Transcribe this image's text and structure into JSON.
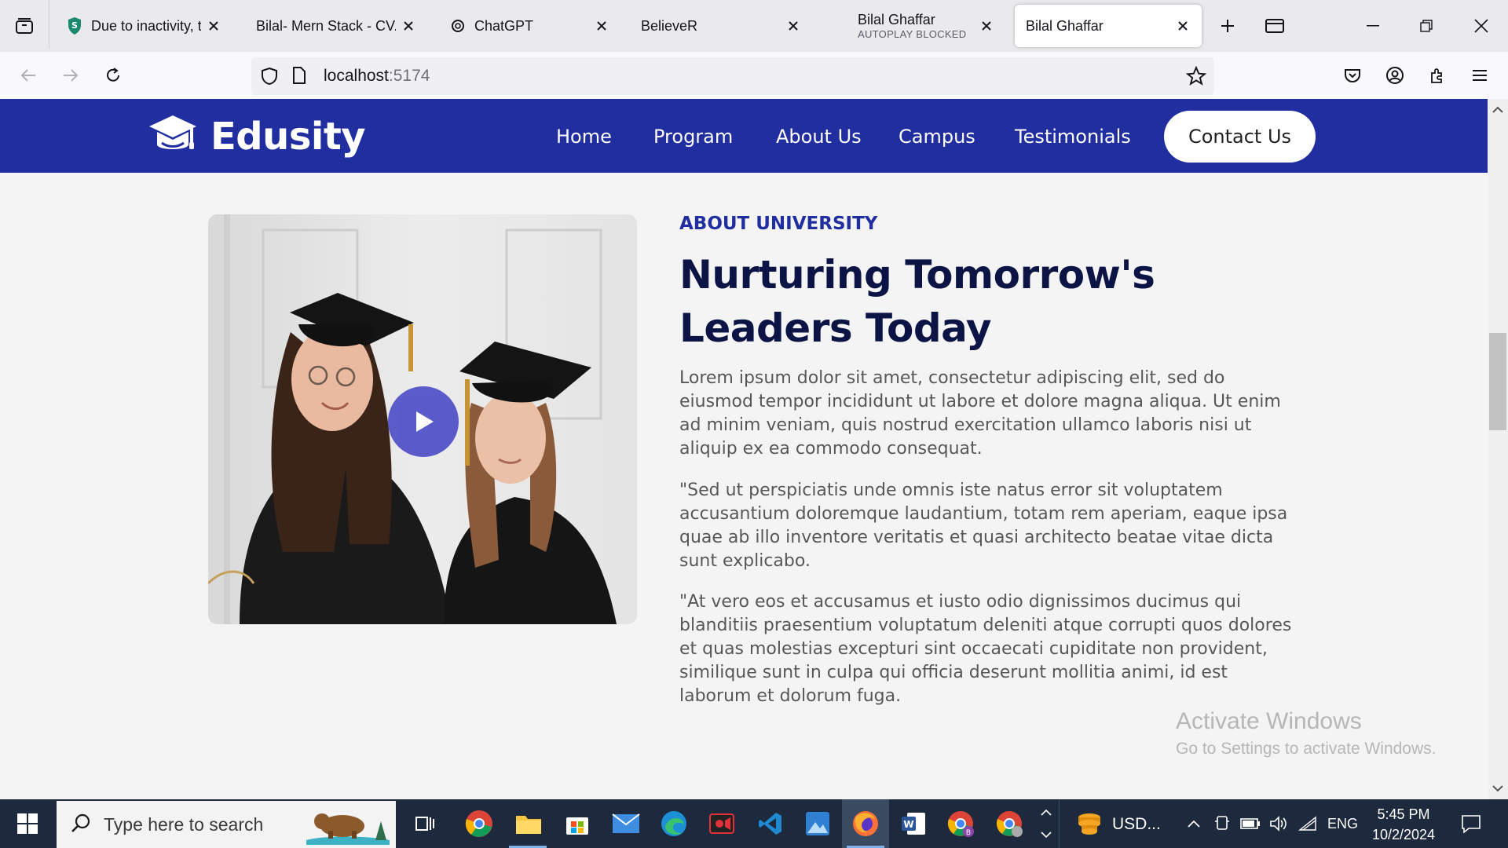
{
  "browser": {
    "tabs": [
      {
        "title": "Due to inactivity, the",
        "favicon": "shield-s-icon"
      },
      {
        "title": "Bilal- Mern Stack - CV.p",
        "favicon": "none"
      },
      {
        "title": "ChatGPT",
        "favicon": "openai-icon"
      },
      {
        "title": "BelieveR",
        "favicon": "none"
      },
      {
        "title": "Bilal Ghaffar",
        "subtitle": "AUTOPLAY BLOCKED",
        "favicon": "none"
      },
      {
        "title": "Bilal Ghaffar",
        "favicon": "none",
        "active": true
      }
    ],
    "url_host": "localhost",
    "url_port": ":5174"
  },
  "site": {
    "brand": "Edusity",
    "colors": {
      "primary": "#212ea0",
      "heading": "#0c1446"
    },
    "nav": [
      "Home",
      "Program",
      "About Us",
      "Campus",
      "Testimonials"
    ],
    "contact_label": "Contact Us",
    "about": {
      "label": "ABOUT UNIVERSITY",
      "title": "Nurturing Tomorrow's Leaders Today",
      "paragraphs": [
        "Lorem ipsum dolor sit amet, consectetur adipiscing elit, sed do eiusmod tempor incididunt ut labore et dolore magna aliqua. Ut enim ad minim veniam, quis nostrud exercitation ullamco laboris nisi ut aliquip ex ea commodo consequat.",
        "\"Sed ut perspiciatis unde omnis iste natus error sit voluptatem accusantium doloremque laudantium, totam rem aperiam, eaque ipsa quae ab illo inventore veritatis et quasi architecto beatae vitae dicta sunt explicabo.",
        "\"At vero eos et accusamus et iusto odio dignissimos ducimus qui blanditiis praesentium voluptatum deleniti atque corrupti quos dolores et quas molestias excepturi sint occaecati cupiditate non provident, similique sunt in culpa qui officia deserunt mollitia animi, id est laborum et dolorum fuga."
      ]
    }
  },
  "watermark": {
    "line1": "Activate Windows",
    "line2": "Go to Settings to activate Windows."
  },
  "taskbar": {
    "search_placeholder": "Type here to search",
    "currency": "USD...",
    "language": "ENG",
    "time": "5:45 PM",
    "date": "10/2/2024"
  }
}
